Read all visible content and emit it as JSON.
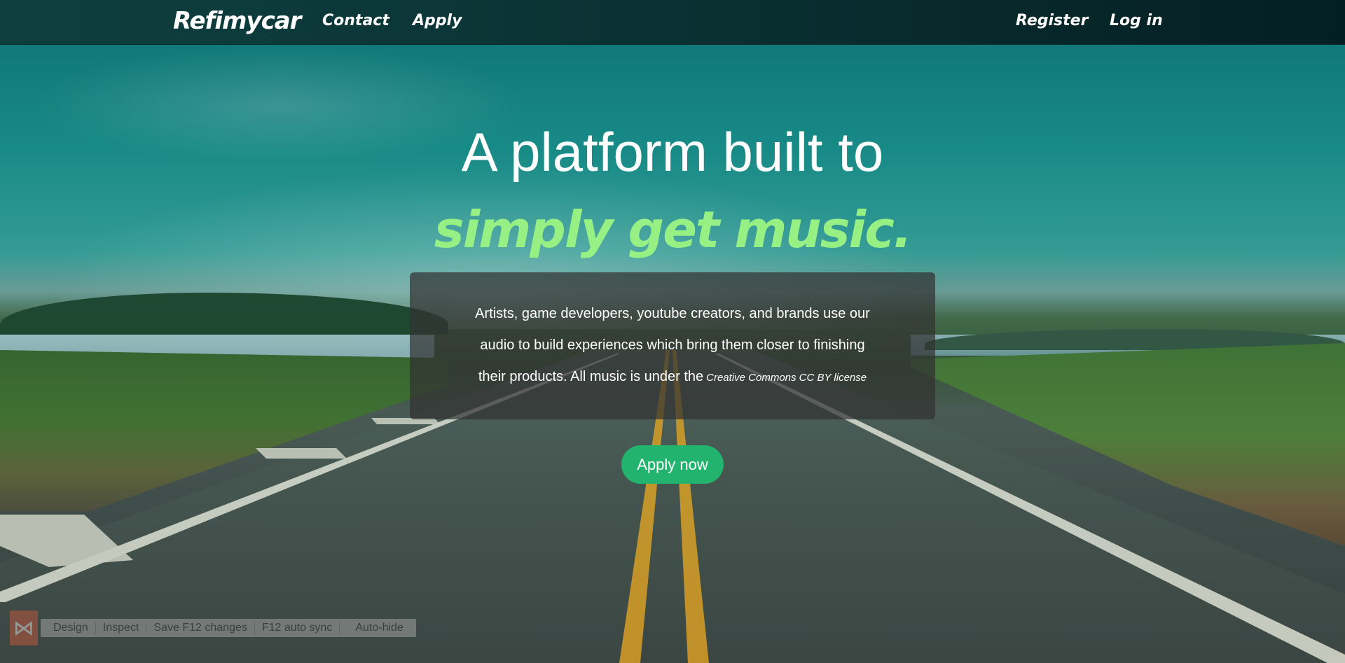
{
  "navbar": {
    "brand": "Refimycar",
    "links": {
      "contact": "Contact",
      "apply": "Apply",
      "register": "Register",
      "login": "Log in"
    }
  },
  "hero": {
    "title": "A platform built to",
    "subtitle": "simply get music.",
    "description": {
      "line1": "Artists, game developers, youtube creators, and brands use our",
      "line2": "audio to build experiences which bring them closer to finishing",
      "line3": "their products. All music is under the",
      "license_link": "Creative Commons CC BY license"
    },
    "cta_label": "Apply now"
  },
  "dev_toolbar": {
    "items": [
      "Design",
      "Inspect",
      "Save F12 changes",
      "F12 auto sync",
      "Auto-hide"
    ]
  },
  "colors": {
    "accent_green": "#22b36e",
    "subtitle_green": "#97f083",
    "navbar_bg": "#0a3133"
  },
  "icons": {
    "dev_logo": "vs-logo-icon"
  }
}
